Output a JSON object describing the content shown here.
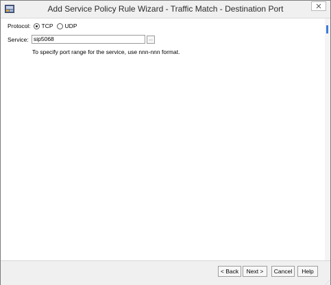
{
  "window": {
    "title": "Add Service Policy Rule Wizard - Traffic Match - Destination Port",
    "icon": "asdm-app-icon",
    "close_icon": "close-icon"
  },
  "form": {
    "protocol_label": "Protocol:",
    "protocol_options": [
      {
        "label": "TCP",
        "selected": true
      },
      {
        "label": "UDP",
        "selected": false
      }
    ],
    "service_label": "Service:",
    "service_value": "sip5068",
    "browse_label": "...",
    "hint": "To specify port range for the service, use nnn-nnn format."
  },
  "buttons": {
    "back": "< Back",
    "next": "Next >",
    "cancel": "Cancel",
    "help": "Help"
  },
  "colors": {
    "scroll_thumb": "#3d7bd9"
  }
}
